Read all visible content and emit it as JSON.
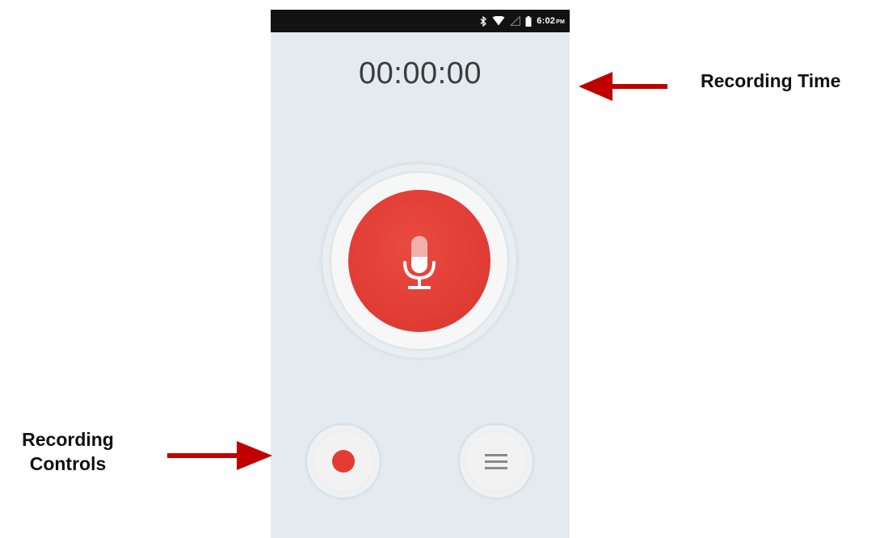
{
  "status_bar": {
    "time": "6:02",
    "ampm": "PM",
    "icons": [
      "bluetooth-icon",
      "wifi-icon",
      "signal-icon",
      "battery-icon"
    ]
  },
  "recorder": {
    "elapsed_time": "00:00:00",
    "mic_icon": "microphone-icon",
    "record_icon": "record-dot-icon",
    "list_icon": "list-icon"
  },
  "annotations": {
    "recording_time": "Recording Time",
    "recording_controls_line1": "Recording",
    "recording_controls_line2": "Controls"
  },
  "colors": {
    "accent_red": "#df3b33",
    "annotation_arrow": "#c00000",
    "screen_background": "#e3ebf0"
  }
}
